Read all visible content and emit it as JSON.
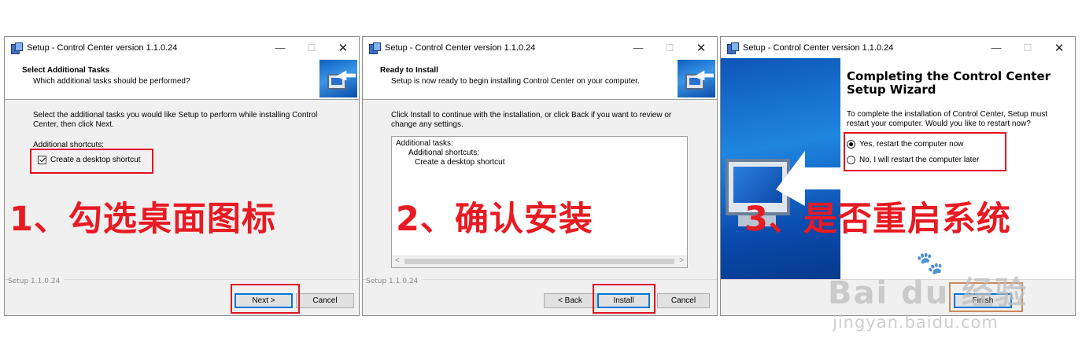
{
  "panels": [
    {
      "window_title": "Setup - Control Center version 1.1.0.24",
      "page_title": "Select Additional Tasks",
      "page_subtitle": "Which additional tasks should be performed?",
      "body_text_1": "Select the additional tasks you would like Setup to perform while installing Control",
      "body_text_2": "Center, then click Next.",
      "section_label": "Additional shortcuts:",
      "checkbox_label": "Create a desktop shortcut",
      "checkbox_checked": true,
      "footer_version": "Setup 1.1.0.24",
      "next_button": "Next >",
      "cancel_button": "Cancel",
      "annotation": "1、勾选桌面图标"
    },
    {
      "window_title": "Setup - Control Center version 1.1.0.24",
      "page_title": "Ready to Install",
      "page_subtitle": "Setup is now ready to begin installing Control Center on your computer.",
      "body_text_1": "Click Install to continue with the installation, or click Back if you want to review or",
      "body_text_2": "change any settings.",
      "memo_lines": [
        "Additional tasks:",
        "Additional shortcuts:",
        "Create a desktop shortcut"
      ],
      "footer_version": "Setup 1.1.0.24",
      "back_button": "< Back",
      "install_button": "Install",
      "cancel_button": "Cancel",
      "annotation": "2、确认安装"
    },
    {
      "window_title": "Setup - Control Center version 1.1.0.24",
      "finish_title_1": "Completing the Control Center",
      "finish_title_2": "Setup Wizard",
      "body_text_1": "To complete the installation of Control Center, Setup must",
      "body_text_2": "restart your computer. Would you like to restart now?",
      "radio_yes": "Yes, restart the computer now",
      "radio_no": "No, I will restart the computer later",
      "radio_selected": "yes",
      "finish_button": "Finish",
      "annotation": "3、是否重启系统"
    }
  ],
  "watermark": {
    "brand": "Bai du 经验",
    "url": "jingyan.baidu.com"
  },
  "colors": {
    "annotation_red": "#e81a22",
    "highlight_box": "#e0141e",
    "default_button": "#0078d7"
  },
  "icons": [
    "setup-app-icon",
    "minimize-icon",
    "maximize-icon",
    "close-icon",
    "wizard-monitor-icon",
    "paw-icon"
  ]
}
